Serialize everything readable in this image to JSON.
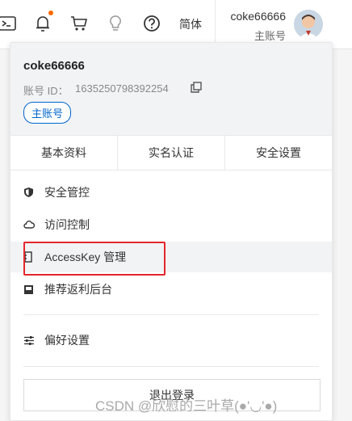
{
  "topbar": {
    "lang": "简体",
    "user": {
      "name": "coke66666",
      "role": "主账号"
    }
  },
  "account": {
    "name": "coke66666",
    "id_label": "账号 ID：",
    "id_value": "1635250798392254",
    "badge": "主账号"
  },
  "tabs": [
    "基本资料",
    "实名认证",
    "安全设置"
  ],
  "menu": [
    {
      "label": "安全管控",
      "icon": "shield-icon"
    },
    {
      "label": "访问控制",
      "icon": "cloud-icon"
    },
    {
      "label": "AccessKey 管理",
      "icon": "key-icon"
    },
    {
      "label": "推荐返利后台",
      "icon": "gift-icon"
    },
    {
      "label": "偏好设置",
      "icon": "sliders-icon"
    }
  ],
  "logout": "退出登录",
  "watermark": "CSDN @欣慰的三叶草(●'◡'●)",
  "colors": {
    "accent": "#0064c8",
    "notice": "#ff6a00",
    "highlight": "#e4262d"
  }
}
